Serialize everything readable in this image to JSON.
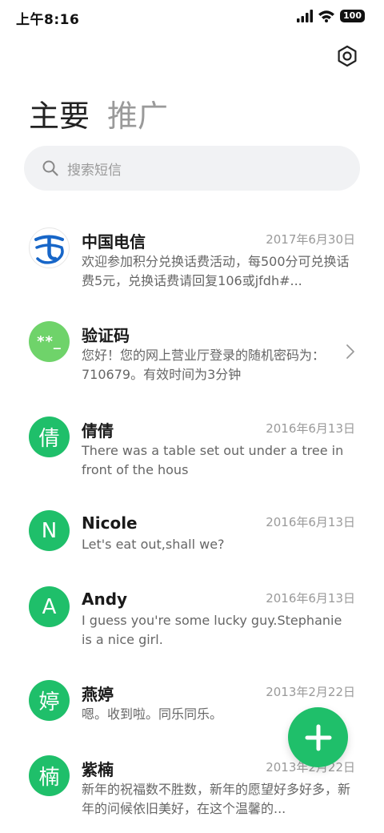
{
  "status_bar": {
    "time": "上午8:16",
    "battery": "100"
  },
  "tabs": [
    {
      "label": "主要"
    },
    {
      "label": "推广"
    }
  ],
  "search": {
    "placeholder": "搜索短信"
  },
  "conversations": [
    {
      "name": "中国电信",
      "date": "2017年6月30日",
      "preview": "欢迎参加积分兑换话费活动，每500分可兑换话费5元，兑换话费请回复106或jfdh#...",
      "avatar": "telecom-logo"
    },
    {
      "name": "验证码",
      "date": "",
      "preview": "您好！您的网上营业厅登录的随机密码为：710679。有效时间为3分钟",
      "avatar": "**_"
    },
    {
      "name": "倩倩",
      "date": "2016年6月13日",
      "preview": "There was a table set out under a tree in front of the hous",
      "avatar": "倩"
    },
    {
      "name": "Nicole",
      "date": "2016年6月13日",
      "preview": "Let's eat out,shall we?",
      "avatar": "N"
    },
    {
      "name": "Andy",
      "date": "2016年6月13日",
      "preview": "I guess you're some lucky guy.Stephanie is a nice girl.",
      "avatar": "A"
    },
    {
      "name": "燕婷",
      "date": "2013年2月22日",
      "preview": "嗯。收到啦。同乐同乐。",
      "avatar": "婷"
    },
    {
      "name": "紫楠",
      "date": "2013年2月22日",
      "preview": "新年的祝福数不胜数，新年的愿望好多好多，新年的问候依旧美好，在这个温馨的...",
      "avatar": "楠"
    }
  ],
  "colors": {
    "accent": "#1fbf6a",
    "avatar_light": "#6fd36a",
    "search_bg": "#f1f2f4"
  }
}
